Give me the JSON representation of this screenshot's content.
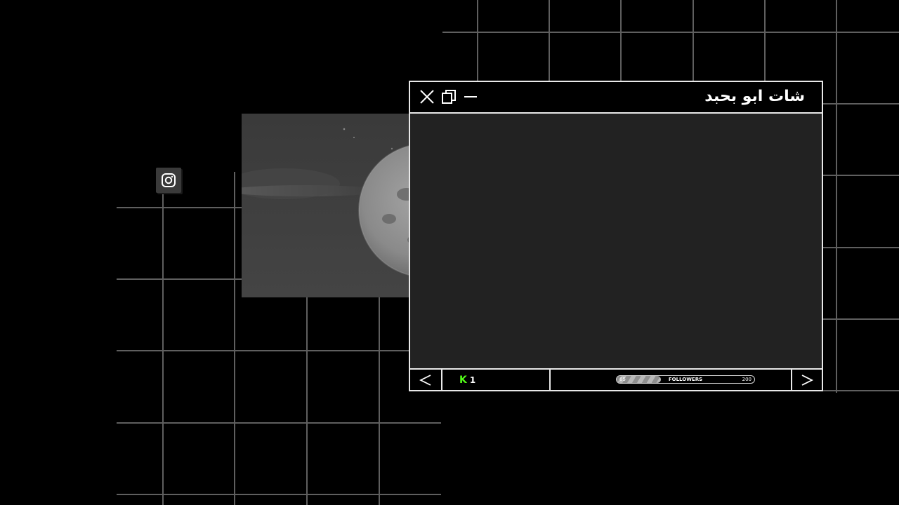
{
  "window": {
    "title": "شات ابو بحبد",
    "controls": {
      "close": "close-icon",
      "restore": "restore-icon",
      "minimize": "minimize-icon"
    }
  },
  "footer": {
    "prev_icon": "chevron-left-icon",
    "next_icon": "chevron-right-icon",
    "kick_icon": "kick-icon",
    "kick_letter": "K",
    "kick_count": "1",
    "followers": {
      "label": "FOLLOWERS",
      "current": "65",
      "goal": "200",
      "progress": 0.32
    }
  },
  "social_icon": "instagram-icon",
  "colors": {
    "background": "#000000",
    "window_border": "#e9e9e9",
    "content_bg": "#222222",
    "kick_green": "#53fc18",
    "grid_lines": "#5f5f5f"
  }
}
